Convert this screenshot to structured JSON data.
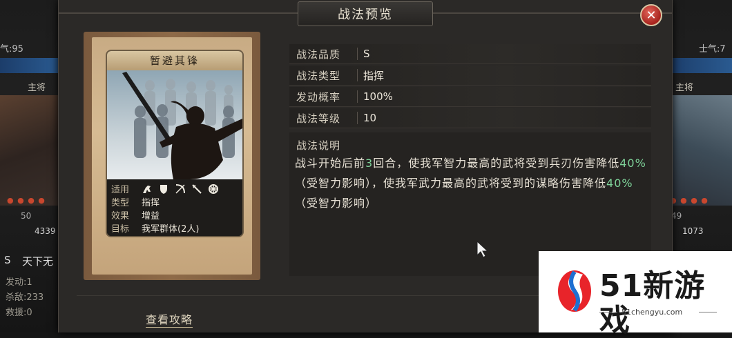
{
  "background": {
    "left": {
      "morale": "气:95",
      "role": "主将",
      "power": "4339",
      "level": "50",
      "tag": "S",
      "skill": "天下无",
      "stats": [
        "发动:1",
        "杀敌:233",
        "救援:0"
      ]
    },
    "right": {
      "morale": "士气:7",
      "role": "主将",
      "power": "1073",
      "level": "49"
    }
  },
  "dialog": {
    "title": "战法预览",
    "close_icon": "close-icon",
    "card": {
      "name": "暂避其锋",
      "props": {
        "applicable_label": "适用",
        "type_label": "类型",
        "type_value": "指挥",
        "effect_label": "效果",
        "effect_value": "增益",
        "target_label": "目标",
        "target_value": "我军群体(2人)"
      },
      "unit_icons": [
        "cavalry-icon",
        "shield-icon",
        "bow-icon",
        "spear-icon",
        "wheel-icon"
      ]
    },
    "info": [
      {
        "label": "战法品质",
        "value": "S"
      },
      {
        "label": "战法类型",
        "value": "指挥"
      },
      {
        "label": "发动概率",
        "value": "100%"
      },
      {
        "label": "战法等级",
        "value": "10"
      }
    ],
    "description": {
      "label": "战法说明",
      "part1": "战斗开始后前",
      "rounds": "3",
      "part2": "回合，使我军智力最高的武将受到兵刃伤害降低",
      "pct1": "40%",
      "part3": "（受智力影响），使我军武力最高的武将受到的谋略伤害降低",
      "pct2": "40%",
      "part4": "（受智力影响）"
    },
    "guide_link": "查看攻略"
  },
  "watermark": {
    "brand": "51新游戏",
    "url": "51chengyu.com"
  }
}
